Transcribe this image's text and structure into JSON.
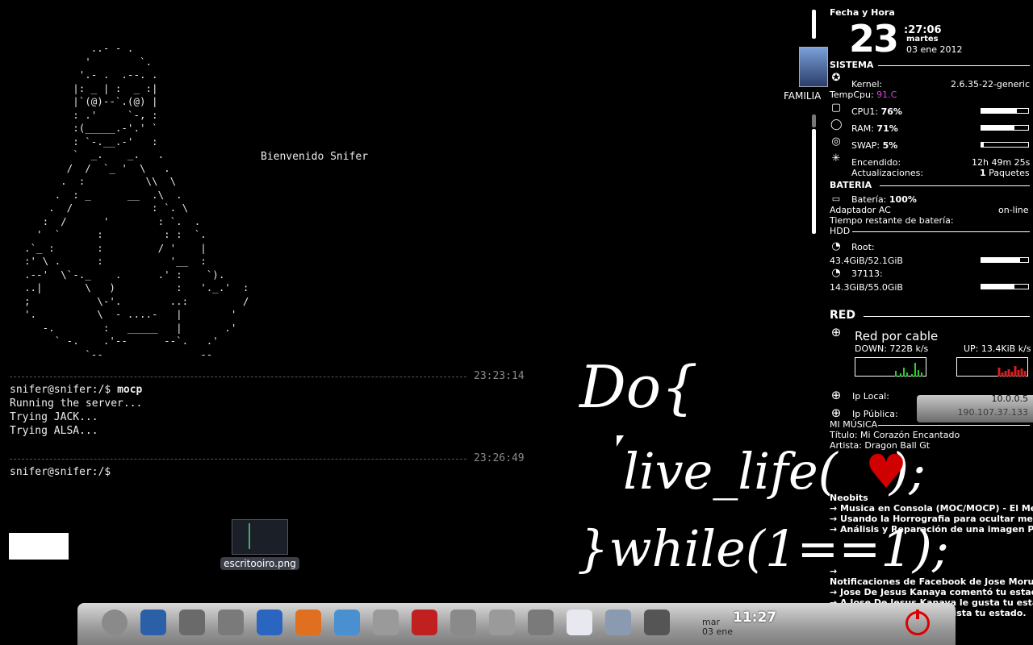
{
  "terminal": {
    "ascii_art": "           ..- - .\n          '        `.\n         '.- .  .--. .\n        |: _ | :  _ :|\n        |`(@)--`.(@) |\n        : .'     `-, :\n        :(_____.-'.' `\n        : `-.__.-'   :\n        `  _.    _.   .\n       /  /  `_ '  \\   .\n      .  :          \\\\  \\\n     .  : _      __  .\\  .\n    .  /             : `. \\\n   :  /      '        : `.  .\n  '  `      :          : :  `.\n.`_ :       :         / '    |\n:' \\ .      :           '__  :\n.--'  \\`-._    .      .' :    `).\n..|       \\   )          :   '._.'  :\n;           \\-'.        ..:         /\n'.          \\  - ....-   |        '\n   -.        :   _____   |       .'\n     ` -.    .'--      --`.   .'\n          `--                --",
    "welcome": "Bienvenido Snifer",
    "sep1_time": "23:23:14",
    "prompt1": "snifer@snifer:/$ ",
    "cmd1": "mocp",
    "out1": "Running the server...",
    "out2": "Trying JACK...",
    "out3": "Trying ALSA...",
    "sep2_time": "23:26:49",
    "prompt2": "snifer@snifer:/$"
  },
  "desktop_icon": {
    "label": "escritooiro.png"
  },
  "wallpaper": {
    "line1": "Do{",
    "line2": "live_life(",
    "line2b": ");",
    "heart": "♥",
    "line3": "}while(1==1);"
  },
  "widget": {
    "familia": "FAMILIA"
  },
  "conky": {
    "fecha_title": "Fecha y Hora",
    "day": "23",
    "time": ":27:06",
    "weekday": "martes",
    "date": "03 ene 2012",
    "sistema": "SISTEMA",
    "kernel_label": "Kernel:",
    "kernel_value": "2.6.35-22-generic",
    "tempcpu_label": "TempCpu:",
    "tempcpu_value": "91.C",
    "cpu_label": "CPU1:",
    "cpu_value": "76%",
    "cpu_pct": 76,
    "ram_label": "RAM:",
    "ram_value": "71%",
    "ram_pct": 71,
    "swap_label": "SWAP:",
    "swap_value": "5%",
    "swap_pct": 5,
    "encendido_label": "Encendido:",
    "encendido_value": "12h 49m 25s",
    "actualizaciones_label": "Actualizaciones:",
    "actualizaciones_count": "1",
    "actualizaciones_unit": "Paquetes",
    "bateria": "BATERIA",
    "bateria_label": "Batería:",
    "bateria_value": "100%",
    "adaptador_label": "Adaptador AC",
    "adaptador_value": "on-line",
    "tiempo_label": "Tiempo restante de batería:",
    "hdd": "HDD",
    "root_label": "Root:",
    "root_value": "43.4GiB/52.1GiB",
    "root_pct": 83,
    "disk2_label": "37113:",
    "disk2_value": "14.3GiB/55.0GiB",
    "disk2_pct": 70,
    "red": "RED",
    "red_por_cable": "Red por cable",
    "down": "DOWN: 722B k/s",
    "up": "UP: 13.4KiB k/s",
    "ip_local_label": "Ip Local:",
    "ip_local_value": "10.0.0.5",
    "ip_publica_label": "Ip Pública:",
    "ip_publica_value": "190.107.37.133",
    "musica": "MI MÚSICA",
    "titulo": "Título: Mi Corazón Encantado",
    "artista": "Artista: Dragon Ball Gt",
    "neobits": "Neobits",
    "news1": "→ Musica en Consola (MOC/MOCP) - El Me",
    "news2": "→ Usando la Horrografia para ocultar men",
    "news3": "→ Análisis y Reparación de una imagen PN",
    "news4": "→",
    "fb_title": "Notificaciones de Facebook de Jose Morun",
    "fb1": "→ Jose De Jesus Kanaya comentó tu estad",
    "fb2": "→ A Jose De Jesus Kanaya le gusta tu esta",
    "fb3": "→ A Alejandra Paola le gusta tu estado."
  },
  "dock": {
    "date_top": "mar",
    "date_bottom": "03 ene",
    "time": "11:27",
    "icons": [
      "ubuntu-icon",
      "monitor-icon",
      "pdf-icon",
      "scanner-icon",
      "dictionary-icon",
      "firefox-icon",
      "bot-icon",
      "hearts-icon",
      "system-monitor-icon",
      "chat-icon",
      "microphone-icon",
      "headphones-icon",
      "text-editor-icon",
      "users-icon",
      "terminal-icon"
    ]
  },
  "colors": {
    "accent_temp": "#e040e0",
    "heart": "#d10000"
  }
}
